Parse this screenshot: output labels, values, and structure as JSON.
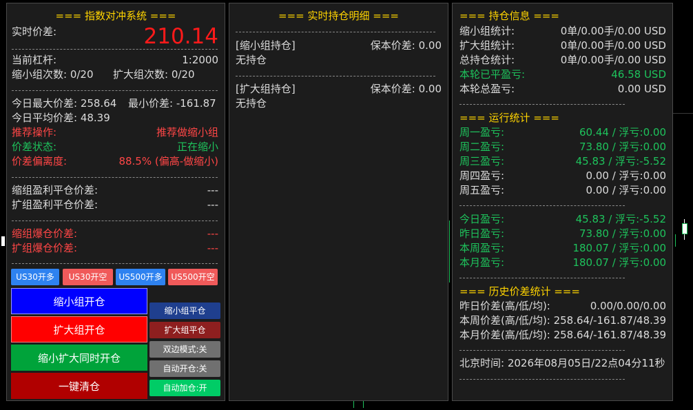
{
  "panel_left": {
    "title": "=== 指数对冲系统 ===",
    "price_label": "实时价差:",
    "price_value": "210.14",
    "leverage_label": "当前杠杆:",
    "leverage_value": "1:2000",
    "shrink_count": "缩小组次数: 0/20",
    "expand_count": "扩大组次数: 0/20",
    "today_max": "今日最大价差: 258.64",
    "today_min": "最小价差: -161.87",
    "today_avg": "今日平均价差: 48.39",
    "rec_op_label": "推荐操作:",
    "rec_op_value": "推荐做缩小组",
    "spread_state_label": "价差状态:",
    "spread_state_value": "正在缩小",
    "deviation_label": "价差偏离度:",
    "deviation_value": "88.5% (偏高-做缩小)",
    "shrink_tp_label": "缩组盈利平仓价差:",
    "shrink_tp_value": "---",
    "expand_tp_label": "扩组盈利平仓价差:",
    "expand_tp_value": "---",
    "shrink_liq_label": "缩组爆仓价差:",
    "shrink_liq_value": "---",
    "expand_liq_label": "扩组爆仓价差:",
    "expand_liq_value": "---",
    "buttons": {
      "us30_long": "US30开多",
      "us30_short": "US30开空",
      "us500_long": "US500开多",
      "us500_short": "US500开空",
      "shrink_open": "缩小组开仓",
      "expand_open": "扩大组开仓",
      "both_open": "缩小扩大同时开仓",
      "close_all": "一键清仓",
      "shrink_close": "缩小组平仓",
      "expand_close": "扩大组平仓",
      "dual_mode": "双边模式:关",
      "auto_open": "自动开仓:关",
      "auto_add": "自动加仓:开"
    }
  },
  "panel_middle": {
    "title": "=== 实时持仓明细 ===",
    "shrink_group_label": "[缩小组持仓]",
    "shrink_breakeven": "保本价差: 0.00",
    "shrink_status": "无持仓",
    "expand_group_label": "[扩大组持仓]",
    "expand_breakeven": "保本价差: 0.00",
    "expand_status": "无持仓"
  },
  "panel_right": {
    "title": "=== 持仓信息 ===",
    "positions": [
      {
        "label": "缩小组统计:",
        "value": "0单/0.00手/0.00 USD"
      },
      {
        "label": "扩大组统计:",
        "value": "0单/0.00手/0.00 USD"
      },
      {
        "label": "总持仓统计:",
        "value": "0单/0.00手/0.00 USD"
      },
      {
        "label": "本轮已平盈亏:",
        "value": "46.58 USD"
      },
      {
        "label": "本轮总盈亏:",
        "value": "0.00 USD"
      }
    ],
    "run_title": "=== 运行统计 ===",
    "weekdays": [
      {
        "label": "周一盈亏:",
        "value": "60.44 / 浮亏:0.00"
      },
      {
        "label": "周二盈亏:",
        "value": "73.80 / 浮亏:0.00"
      },
      {
        "label": "周三盈亏:",
        "value": "45.83 / 浮亏:-5.52"
      },
      {
        "label": "周四盈亏:",
        "value": "0.00 / 浮亏:0.00"
      },
      {
        "label": "周五盈亏:",
        "value": "0.00 / 浮亏:0.00"
      }
    ],
    "periods": [
      {
        "label": "今日盈亏:",
        "value": "45.83 / 浮亏:-5.52"
      },
      {
        "label": "昨日盈亏:",
        "value": "73.80 / 浮亏:0.00"
      },
      {
        "label": "本周盈亏:",
        "value": "180.07 / 浮亏:0.00"
      },
      {
        "label": "本月盈亏:",
        "value": "180.07 / 浮亏:0.00"
      }
    ],
    "history_title": "=== 历史价差统计 ===",
    "history": [
      {
        "label": "昨日价差(高/低/均):",
        "value": "0.00/0.00/0.00"
      },
      {
        "label": "本周价差(高/低/均):",
        "value": "258.64/-161.87/48.39"
      },
      {
        "label": "本月价差(高/低/均):",
        "value": "258.64/-161.87/48.39"
      }
    ],
    "beijing_time": "北京时间: 2026年08月05日/22点04分11秒"
  },
  "colors": {
    "title": "#ffd400",
    "green": "#1ec35c",
    "red": "#ff4646",
    "price": "#ff1a1a"
  }
}
